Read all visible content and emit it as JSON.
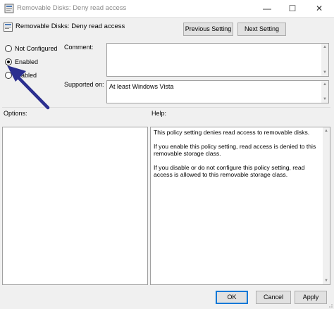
{
  "window": {
    "title": "Removable Disks: Deny read access",
    "minimize": "—",
    "maximize": "☐",
    "close": "✕"
  },
  "header": {
    "policy_name": "Removable Disks: Deny read access",
    "prev_label": "Previous Setting",
    "next_label": "Next Setting"
  },
  "state": {
    "options": [
      {
        "label": "Not Configured",
        "selected": false
      },
      {
        "label": "Enabled",
        "selected": true
      },
      {
        "label": "abled",
        "selected": false
      }
    ]
  },
  "comment": {
    "label": "Comment:",
    "value": ""
  },
  "supported": {
    "label": "Supported on:",
    "value": "At least Windows Vista"
  },
  "options_panel": {
    "label": "Options:"
  },
  "help": {
    "label": "Help:",
    "paragraphs": [
      "This policy setting denies read access to removable disks.",
      "If you enable this policy setting, read access is denied to this removable storage class.",
      "If you disable or do not configure this policy setting, read access is allowed to this removable storage class."
    ]
  },
  "footer": {
    "ok": "OK",
    "cancel": "Cancel",
    "apply": "Apply"
  },
  "colors": {
    "arrow": "#2b2f8f",
    "accent": "#0078d7"
  },
  "icons": [
    "policy-icon",
    "minimize-icon",
    "maximize-icon",
    "close-icon",
    "arrow-annotation-icon",
    "scroll-up-icon",
    "scroll-down-icon",
    "resize-grip-icon"
  ]
}
